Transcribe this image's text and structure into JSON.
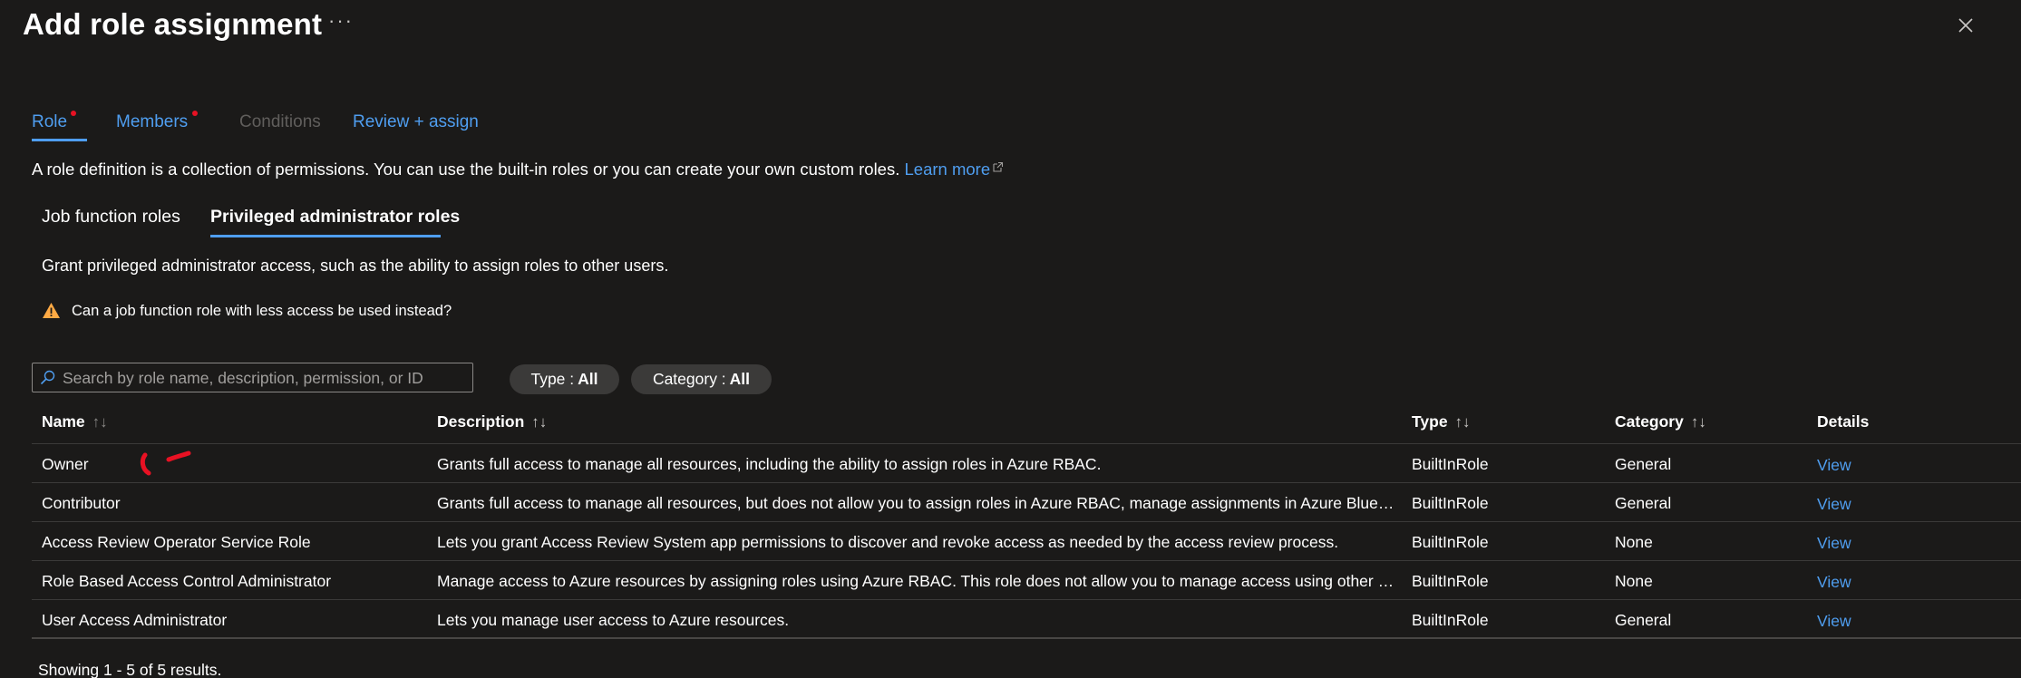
{
  "header": {
    "title": "Add role assignment",
    "more_label": "···"
  },
  "tabs": [
    {
      "label": "Role",
      "required": true,
      "state": "active"
    },
    {
      "label": "Members",
      "required": true,
      "state": "enabled"
    },
    {
      "label": "Conditions",
      "required": false,
      "state": "disabled"
    },
    {
      "label": "Review + assign",
      "required": false,
      "state": "enabled"
    }
  ],
  "intro": {
    "text": "A role definition is a collection of permissions. You can use the built-in roles or you can create your own custom roles. ",
    "link": "Learn more"
  },
  "role_tabs": [
    {
      "label": "Job function roles",
      "selected": false
    },
    {
      "label": "Privileged administrator roles",
      "selected": true
    }
  ],
  "grant_text": "Grant privileged administrator access, such as the ability to assign roles to other users.",
  "warning_text": "Can a job function role with less access be used instead?",
  "search": {
    "placeholder": "Search by role name, description, permission, or ID",
    "value": ""
  },
  "filters": [
    {
      "label": "Type :",
      "value": "All"
    },
    {
      "label": "Category :",
      "value": "All"
    }
  ],
  "table": {
    "columns": [
      "Name",
      "Description",
      "Type",
      "Category",
      "Details"
    ],
    "rows": [
      {
        "name": "Owner",
        "description": "Grants full access to manage all resources, including the ability to assign roles in Azure RBAC.",
        "type": "BuiltInRole",
        "category": "General",
        "details": "View"
      },
      {
        "name": "Contributor",
        "description": "Grants full access to manage all resources, but does not allow you to assign roles in Azure RBAC, manage assignments in Azure Blueprints, or share image galleries.",
        "type": "BuiltInRole",
        "category": "General",
        "details": "View"
      },
      {
        "name": "Access Review Operator Service Role",
        "description": "Lets you grant Access Review System app permissions to discover and revoke access as needed by the access review process.",
        "type": "BuiltInRole",
        "category": "None",
        "details": "View"
      },
      {
        "name": "Role Based Access Control Administrator",
        "description": "Manage access to Azure resources by assigning roles using Azure RBAC. This role does not allow you to manage access using other ways, such as Azure Policy.",
        "type": "BuiltInRole",
        "category": "None",
        "details": "View"
      },
      {
        "name": "User Access Administrator",
        "description": "Lets you manage user access to Azure resources.",
        "type": "BuiltInRole",
        "category": "General",
        "details": "View"
      }
    ]
  },
  "footer": "Showing 1 - 5 of 5 results.",
  "colors": {
    "background": "#1b1a19",
    "accent": "#4f9ef0",
    "required": "#e81123",
    "warning": "#ffaa44",
    "pill": "#3b3a39"
  }
}
